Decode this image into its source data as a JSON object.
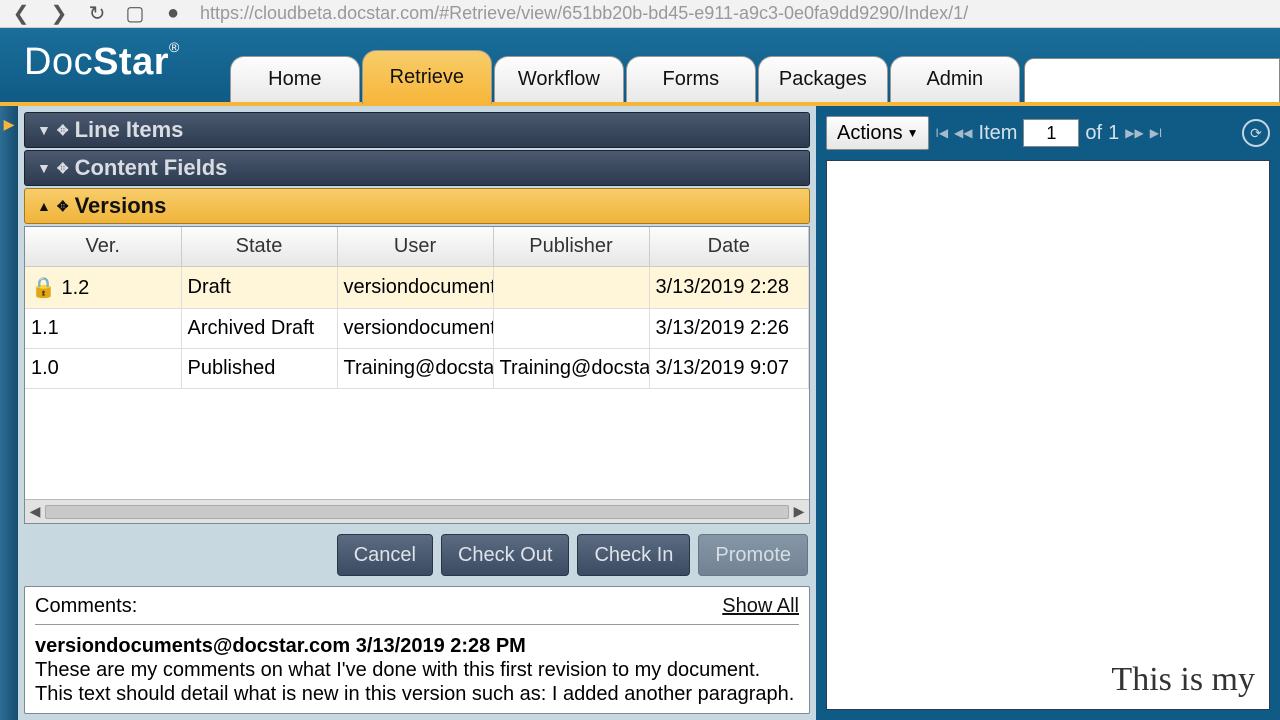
{
  "browser": {
    "url": "https://cloudbeta.docstar.com/#Retrieve/view/651bb20b-bd45-e911-a9c3-0e0fa9dd9290/Index/1/"
  },
  "logo": {
    "part1": "Doc",
    "part2": "Star",
    "reg": "®"
  },
  "nav": {
    "tabs": [
      {
        "label": "Home",
        "active": false
      },
      {
        "label": "Retrieve",
        "active": true
      },
      {
        "label": "Workflow",
        "active": false
      },
      {
        "label": "Forms",
        "active": false
      },
      {
        "label": "Packages",
        "active": false
      },
      {
        "label": "Admin",
        "active": false
      }
    ]
  },
  "sections": {
    "line_items": "Line Items",
    "content_fields": "Content Fields",
    "versions": "Versions"
  },
  "versions_table": {
    "headers": [
      "Ver.",
      "State",
      "User",
      "Publisher",
      "Date"
    ],
    "rows": [
      {
        "locked": true,
        "ver": "1.2",
        "state": "Draft",
        "user": "versiondocument",
        "publisher": "",
        "date": "3/13/2019 2:28",
        "selected": true
      },
      {
        "locked": false,
        "ver": "1.1",
        "state": "Archived Draft",
        "user": "versiondocument",
        "publisher": "",
        "date": "3/13/2019 2:26",
        "selected": false
      },
      {
        "locked": false,
        "ver": "1.0",
        "state": "Published",
        "user": "Training@docsta",
        "publisher": "Training@docsta",
        "date": "3/13/2019 9:07",
        "selected": false
      }
    ]
  },
  "buttons": {
    "cancel": "Cancel",
    "checkout": "Check Out",
    "checkin": "Check In",
    "promote": "Promote"
  },
  "comments": {
    "label": "Comments:",
    "showall": "Show All",
    "entry": {
      "author": "versiondocuments@docstar.com",
      "timestamp": "3/13/2019 2:28 PM",
      "body": "These are my comments on what I've done with this first revision to my document. This text should detail what is new in this version such as: I added another paragraph."
    }
  },
  "viewer": {
    "actions_label": "Actions",
    "item_label": "Item",
    "item_current": "1",
    "of_label": "of",
    "item_total": "1",
    "doc_snippet": "This is my"
  }
}
